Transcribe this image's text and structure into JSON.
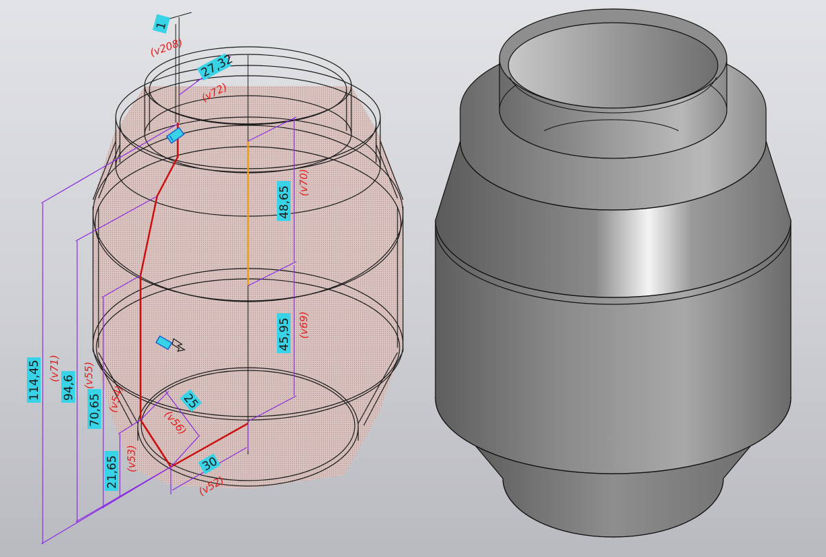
{
  "colors": {
    "background_top": "#e2e3e6",
    "background_bottom": "#b9bac0",
    "dimension_line": "#8a2be2",
    "value_box": "#39d3e8",
    "variable_text": "#e41e1e",
    "profile_line": "#cc1010",
    "axis_line": "#f0a020",
    "wire_edge": "#1a1a1a",
    "shell_fill": "#d4b2ae"
  },
  "sketch": {
    "dimensions": [
      {
        "id": "d208",
        "value": "1",
        "variable": "(v208)"
      },
      {
        "id": "d72",
        "value": "27,32",
        "variable": "(v72)"
      },
      {
        "id": "d70",
        "value": "48,65",
        "variable": "(v70)"
      },
      {
        "id": "d69",
        "value": "45,95",
        "variable": "(v69)"
      },
      {
        "id": "d71",
        "value": "114,45",
        "variable": "(v71)"
      },
      {
        "id": "d55",
        "value": "94,6",
        "variable": "(v55)"
      },
      {
        "id": "d54",
        "value": "70,65",
        "variable": "(v54)"
      },
      {
        "id": "d53",
        "value": "21,65",
        "variable": "(v53)"
      },
      {
        "id": "d56",
        "value": "25",
        "variable": "(v56)"
      },
      {
        "id": "d52",
        "value": "30",
        "variable": "(v52)"
      }
    ],
    "icons": [
      "constraint-icon",
      "direction-arrow-icon"
    ]
  },
  "shaded_model": {
    "style": "shaded-with-edges",
    "shell_color": "#8c8c8c"
  }
}
